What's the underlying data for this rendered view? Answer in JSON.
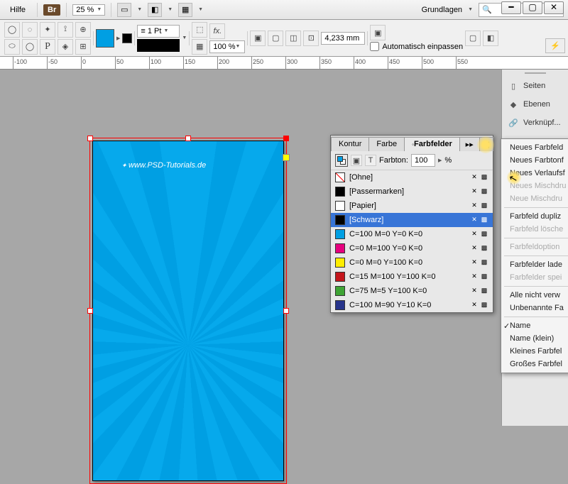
{
  "menubar": {
    "help": "Hilfe",
    "br": "Br",
    "zoom": "25 %",
    "workspace": "Grundlagen"
  },
  "toolbar": {
    "stroke": "1 Pt",
    "pct": "100 %",
    "measure": "4,233 mm",
    "autofit": "Automatisch einpassen"
  },
  "ruler_ticks": [
    "-100",
    "-50",
    "0",
    "50",
    "100",
    "150",
    "200",
    "250",
    "300",
    "350",
    "400",
    "450",
    "500",
    "550"
  ],
  "watermark": "www.PSD-Tutorials.de",
  "dock": {
    "pages": "Seiten",
    "layers": "Ebenen",
    "links": "Verknüpf..."
  },
  "panel": {
    "tabs": {
      "kontur": "Kontur",
      "farbe": "Farbe",
      "swatches": "Farbfelder"
    },
    "tint_label": "Farbton:",
    "tint_value": "100",
    "tint_unit": "%",
    "rows": [
      {
        "name": "[Ohne]",
        "color": "none"
      },
      {
        "name": "[Passermarken]",
        "color": "#000000"
      },
      {
        "name": "[Papier]",
        "color": "#ffffff"
      },
      {
        "name": "[Schwarz]",
        "color": "#000000",
        "active": true
      },
      {
        "name": "C=100 M=0 Y=0 K=0",
        "color": "#009fe3"
      },
      {
        "name": "C=0 M=100 Y=0 K=0",
        "color": "#e6007e"
      },
      {
        "name": "C=0 M=0 Y=100 K=0",
        "color": "#ffed00"
      },
      {
        "name": "C=15 M=100 Y=100 K=0",
        "color": "#c4161c"
      },
      {
        "name": "C=75 M=5 Y=100 K=0",
        "color": "#3fa435"
      },
      {
        "name": "C=100 M=90 Y=10 K=0",
        "color": "#27348b"
      }
    ]
  },
  "ctx": {
    "items": [
      "Neues Farbfeld",
      "Neues Farbtonf",
      "Neues Verlaufsf",
      "Neues Mischdru",
      "Neue Mischdru",
      "Farbfeld dupliz",
      "Farbfeld lösche",
      "Farbfeldoption",
      "Farbfelder lade",
      "Farbfelder spei",
      "Alle nicht verw",
      "Unbenannte Fa",
      "Name",
      "Name (klein)",
      "Kleines Farbfel",
      "Großes Farbfel"
    ]
  }
}
